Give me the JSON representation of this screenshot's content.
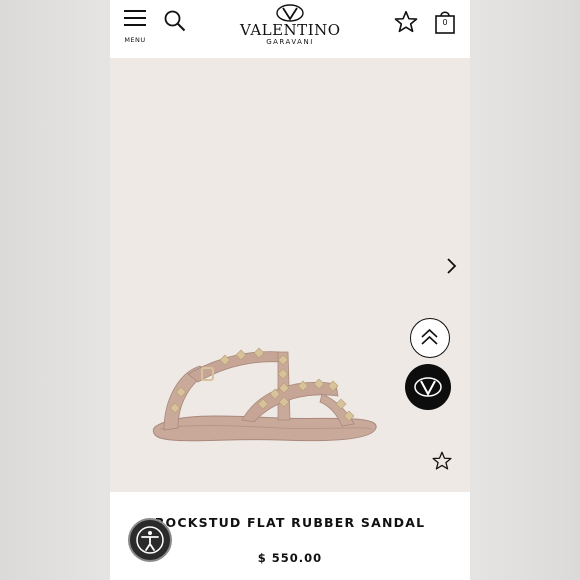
{
  "header": {
    "menu_label": "MENU",
    "logo_brand": "VALENTINO",
    "logo_sub": "GARAVANI",
    "bag_count": "0"
  },
  "product": {
    "title": "ROCKSTUD FLAT RUBBER SANDAL",
    "price": "$ 550.00"
  },
  "icons": {
    "menu": "hamburger-icon",
    "search": "search-icon",
    "wishlist": "star-icon",
    "bag": "shopping-bag-icon",
    "next": "chevron-right-icon",
    "back_to_top": "double-chevron-up-icon",
    "chat": "valentino-v-logo-icon",
    "accessibility": "accessibility-person-icon"
  },
  "colors": {
    "image_background": "#efe9e6",
    "sandal": "#c9a99a",
    "studs": "#d8c29c",
    "text": "#111111",
    "chat_button": "#0d0d0d"
  }
}
